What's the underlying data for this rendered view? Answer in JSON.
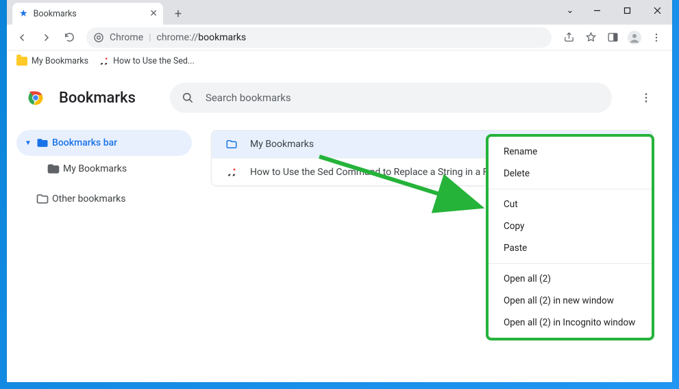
{
  "window": {
    "tab_title": "Bookmarks"
  },
  "omnibox": {
    "label": "Chrome",
    "scheme": "chrome://",
    "path": "bookmarks"
  },
  "bookmarks_bar": {
    "items": [
      {
        "label": "My Bookmarks"
      },
      {
        "label": "How to Use the Sed..."
      }
    ]
  },
  "app": {
    "title": "Bookmarks",
    "search_placeholder": "Search bookmarks"
  },
  "sidebar": {
    "items": [
      {
        "label": "Bookmarks bar"
      },
      {
        "label": "My Bookmarks"
      },
      {
        "label": "Other bookmarks"
      }
    ]
  },
  "list": {
    "rows": [
      {
        "label": "My Bookmarks"
      },
      {
        "label": "How to Use the Sed Command to Replace a String in a File"
      }
    ]
  },
  "context_menu": {
    "items": [
      "Rename",
      "Delete",
      "Cut",
      "Copy",
      "Paste",
      "Open all (2)",
      "Open all (2) in new window",
      "Open all (2) in Incognito window"
    ]
  }
}
